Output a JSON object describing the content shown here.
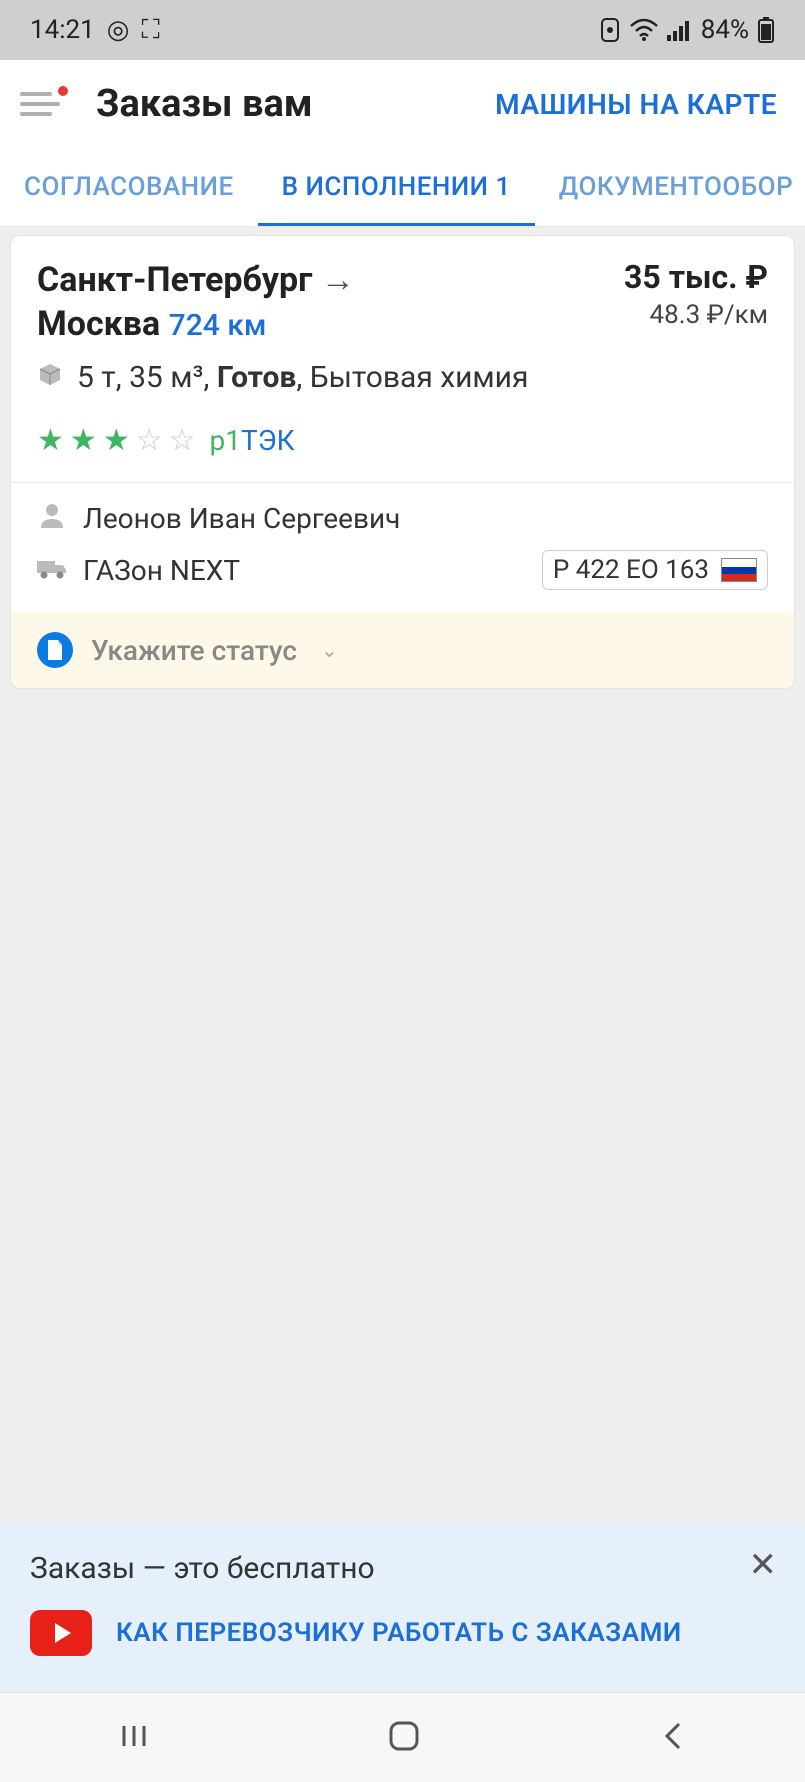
{
  "statusbar": {
    "time": "14:21",
    "battery": "84%"
  },
  "header": {
    "title": "Заказы вам",
    "map_link": "МАШИНЫ НА КАРТЕ"
  },
  "tabs": {
    "items": [
      "СОГЛАСОВАНИЕ",
      "В ИСПОЛНЕНИИ 1",
      "ДОКУМЕНТООБОР"
    ],
    "active_index": 1
  },
  "order": {
    "from": "Санкт-Петербург",
    "to": "Москва",
    "distance": "724 км",
    "price": "35 тыс. ₽",
    "price_per_km": "48.3 ₽/км",
    "cargo_specs": "5 т, 35 м³, ",
    "cargo_status": "Готов",
    "cargo_type": ", Бытовая химия",
    "rating_filled": 3,
    "rating_total": 5,
    "company_p1": "p1",
    "company_tek": "ТЭК",
    "driver_name": "Леонов Иван Сергеевич",
    "vehicle": "ГАЗон NEXT",
    "plate": "Р 422 ЕО 163",
    "status_prompt": "Укажите статус"
  },
  "banner": {
    "title": "Заказы — это бесплатно",
    "link": "КАК ПЕРЕВОЗЧИКУ РАБОТАТЬ С ЗАКАЗАМИ"
  }
}
